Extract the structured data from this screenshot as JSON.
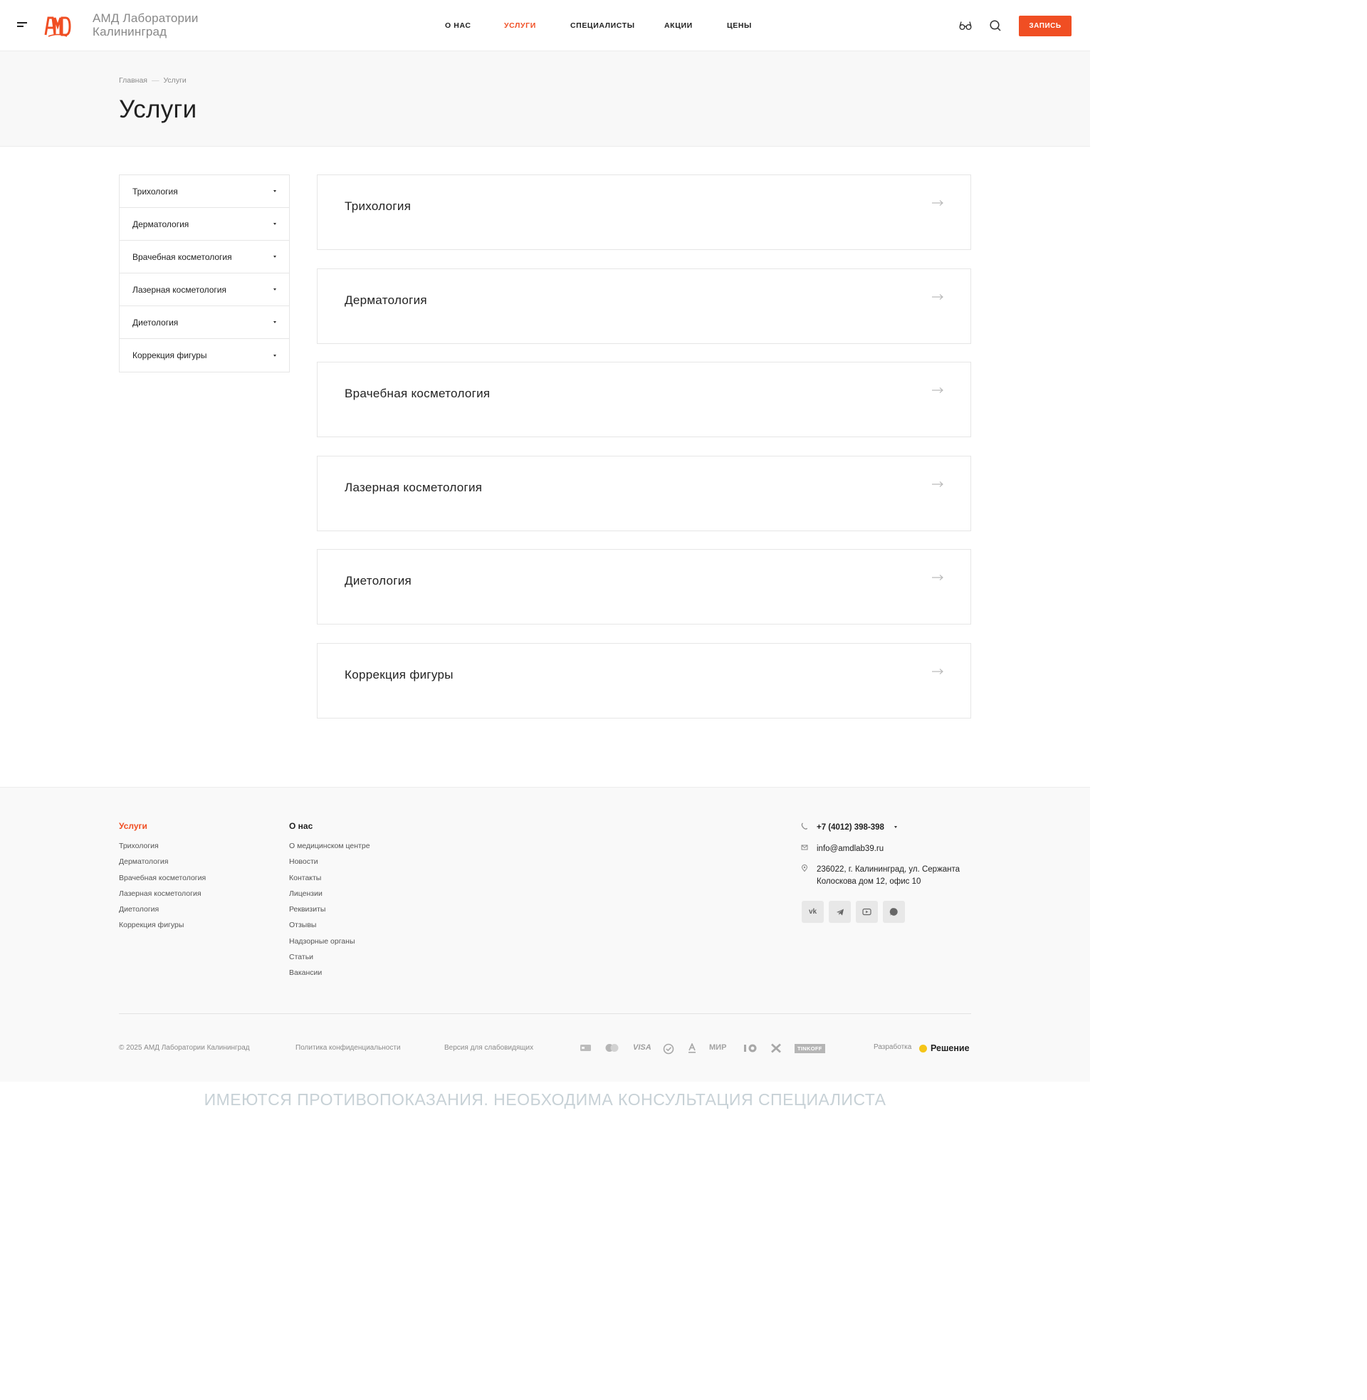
{
  "header": {
    "brand_line1": "АМД Лаборатории",
    "brand_line2": "Калининград",
    "nav": [
      "О НАС",
      "УСЛУГИ",
      "СПЕЦИАЛИСТЫ",
      "АКЦИИ",
      "ЦЕНЫ"
    ],
    "active_nav": "УСЛУГИ",
    "book_label": "ЗАПИСЬ",
    "accent_color": "#f04e23"
  },
  "breadcrumb": {
    "home": "Главная",
    "current": "Услуги"
  },
  "page_title": "Услуги",
  "sidebar": {
    "items": [
      "Трихология",
      "Дерматология",
      "Врачебная косметология",
      "Лазерная косметология",
      "Диетология",
      "Коррекция фигуры"
    ]
  },
  "cards": [
    "Трихология",
    "Дерматология",
    "Врачебная косметология",
    "Лазерная косметология",
    "Диетология",
    "Коррекция фигуры"
  ],
  "footer": {
    "services_title": "Услуги",
    "services": [
      "Трихология",
      "Дерматология",
      "Врачебная косметология",
      "Лазерная косметология",
      "Диетология",
      "Коррекция фигуры"
    ],
    "about_title": "О нас",
    "about": [
      "О медицинском центре",
      "Новости",
      "Контакты",
      "Лицензии",
      "Реквизиты",
      "Отзывы",
      "Надзорные органы",
      "Статьи",
      "Вакансии"
    ],
    "phone": "+7 (4012) 398-398",
    "email": "info@amdlab39.ru",
    "address_line1": "236022, г. Калининград, ул. Сержанта",
    "address_line2": "Колоскова дом 12, офис 10",
    "socials": [
      "vk-icon",
      "telegram-icon",
      "youtube-icon",
      "whatsapp-icon"
    ],
    "copyright": "© 2025 АМД Лаборатории Калининград",
    "privacy": "Политика конфиденциальности",
    "accessibility": "Версия для слабовидящих",
    "payments": {
      "visa": "VISA",
      "mir": "МИР",
      "tinkoff": "TINKOFF"
    },
    "dev_label": "Разработка",
    "dev_name": "Решение"
  },
  "warning": "ИМЕЮТСЯ ПРОТИВОПОКАЗАНИЯ. НЕОБХОДИМА КОНСУЛЬТАЦИЯ СПЕЦИАЛИСТА"
}
